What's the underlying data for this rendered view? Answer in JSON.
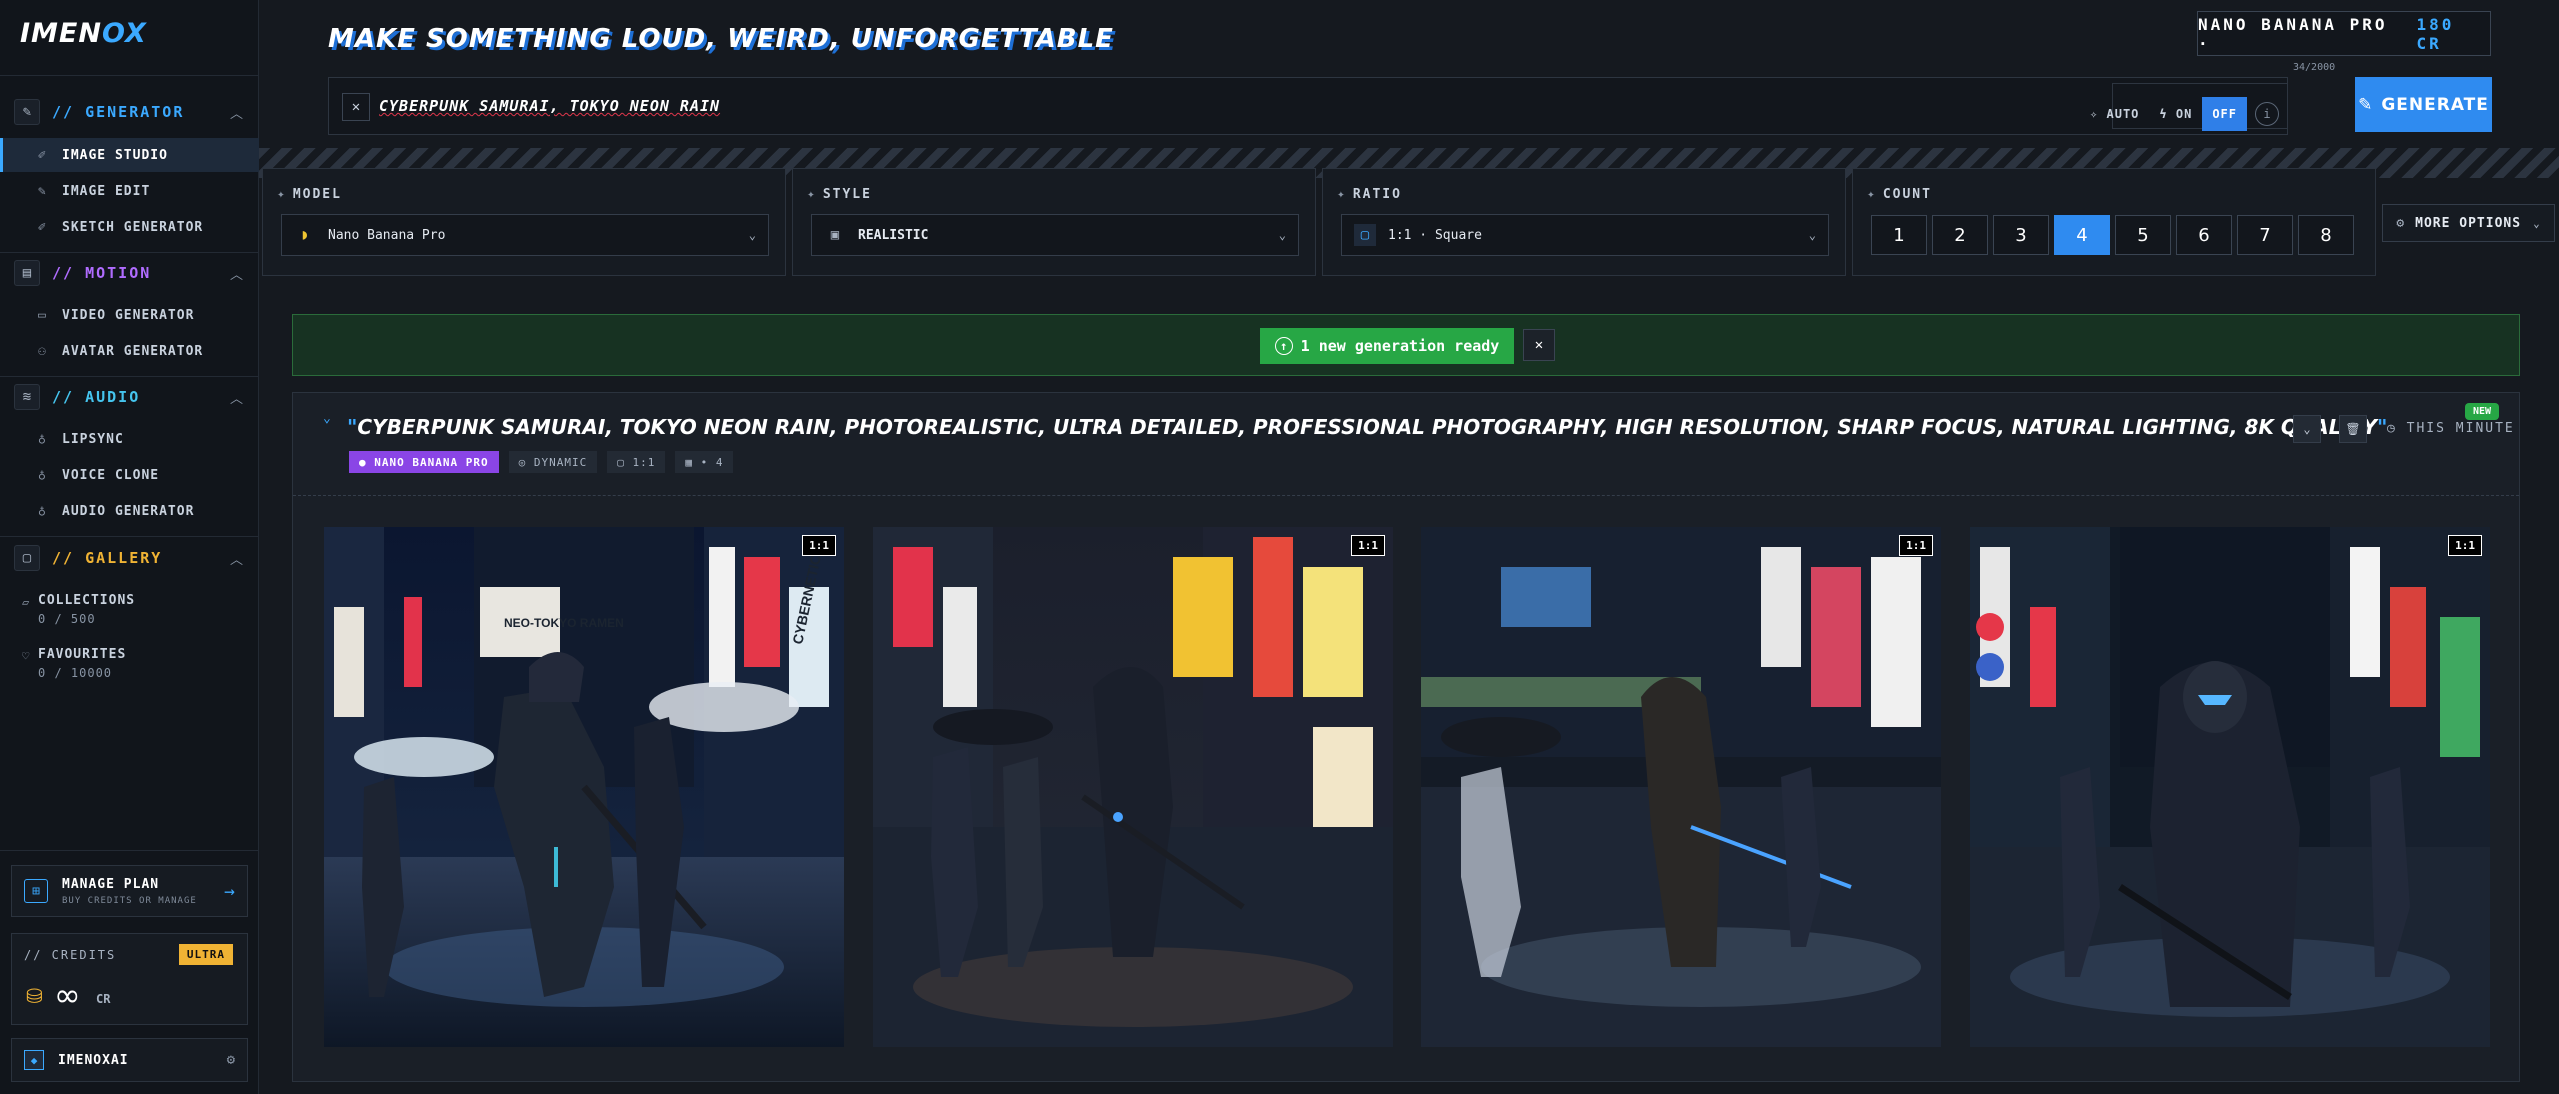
{
  "sidebar": {
    "logo": {
      "main": "IMEN",
      "accent": "OX"
    },
    "sections": [
      {
        "title": "// GENERATOR",
        "items": [
          "IMAGE STUDIO",
          "IMAGE EDIT",
          "SKETCH GENERATOR"
        ]
      },
      {
        "title": "// MOTION",
        "items": [
          "VIDEO GENERATOR",
          "AVATAR GENERATOR"
        ]
      },
      {
        "title": "// AUDIO",
        "items": [
          "LIPSYNC",
          "VOICE CLONE",
          "AUDIO GENERATOR"
        ]
      },
      {
        "title": "// GALLERY",
        "items": [
          {
            "label": "COLLECTIONS",
            "count": "0 / 500"
          },
          {
            "label": "FAVOURITES",
            "count": "0 / 10000"
          }
        ]
      }
    ],
    "plan": {
      "title": "MANAGE PLAN",
      "subtitle": "BUY CREDITS OR MANAGE"
    },
    "credits": {
      "label": "// CREDITS",
      "badge": "ULTRA",
      "value": "∞",
      "unit": "CR"
    },
    "user": {
      "name": "IMENOXAI"
    }
  },
  "header": {
    "headline": "MAKE SOMETHING LOUD, WEIRD, UNFORGETTABLE",
    "model_name": "NANO BANANA PRO ·",
    "model_credits": "180 CR",
    "prompt": "CYBERPUNK SAMURAI, TOKYO NEON RAIN",
    "char_count": "34/2000",
    "enhance_options": [
      "AUTO",
      "ON",
      "OFF"
    ],
    "enhance_selected": "OFF",
    "generate_label": "GENERATE"
  },
  "controls": {
    "model": {
      "label": "MODEL",
      "value": "Nano Banana Pro"
    },
    "style": {
      "label": "STYLE",
      "value": "REALISTIC"
    },
    "ratio": {
      "label": "RATIO",
      "value": "1:1 · Square"
    },
    "count": {
      "label": "COUNT",
      "options": [
        "1",
        "2",
        "3",
        "4",
        "5",
        "6",
        "7",
        "8"
      ],
      "selected": "4"
    },
    "more_options": "MORE OPTIONS"
  },
  "banner": {
    "message": "1 new generation ready"
  },
  "result": {
    "prompt_full": "CYBERPUNK SAMURAI, TOKYO NEON RAIN, PHOTOREALISTIC, ULTRA DETAILED, PROFESSIONAL PHOTOGRAPHY, HIGH RESOLUTION, SHARP FOCUS, NATURAL LIGHTING, 8K QUALITY",
    "tags": [
      "NANO BANANA PRO",
      "DYNAMIC",
      "1:1",
      "• 4"
    ],
    "time": "THIS MINUTE",
    "new_badge": "NEW",
    "images": [
      {
        "ratio": "1:1",
        "signs": [
          "CYBERNETICS",
          "NEO-TOKYO RAMEN"
        ]
      },
      {
        "ratio": "1:1",
        "signs": []
      },
      {
        "ratio": "1:1",
        "signs": []
      },
      {
        "ratio": "1:1",
        "signs": []
      }
    ]
  },
  "colors": {
    "accent": "#2f8bf0",
    "success": "#27a745",
    "violet": "#8a45e6",
    "amber": "#f0b334"
  }
}
